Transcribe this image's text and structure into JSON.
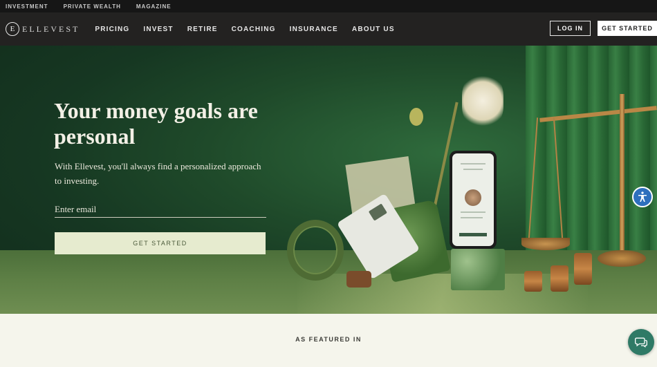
{
  "utility_bar": {
    "items": [
      "INVESTMENT",
      "PRIVATE WEALTH",
      "MAGAZINE"
    ]
  },
  "nav": {
    "logo_mark": "E",
    "logo_text": "ELLEVEST",
    "links": [
      "PRICING",
      "INVEST",
      "RETIRE",
      "COACHING",
      "INSURANCE",
      "ABOUT US"
    ],
    "login_label": "LOG IN",
    "get_started_label": "GET STARTED"
  },
  "hero": {
    "title": "Your money goals are personal",
    "subtitle": "With Ellevest, you'll always find a personalized approach to investing.",
    "email_placeholder": "Enter email",
    "cta_label": "GET STARTED"
  },
  "featured": {
    "label": "AS FEATURED IN"
  },
  "colors": {
    "hero_green": "#1f4a2a",
    "cta_bg": "#e6ebcf",
    "nav_bg": "#232221",
    "chat_teal": "#2f7a66",
    "a11y_blue": "#2e6fbd"
  },
  "icons": {
    "accessibility": "accessibility-icon",
    "chat": "chat-icon"
  }
}
